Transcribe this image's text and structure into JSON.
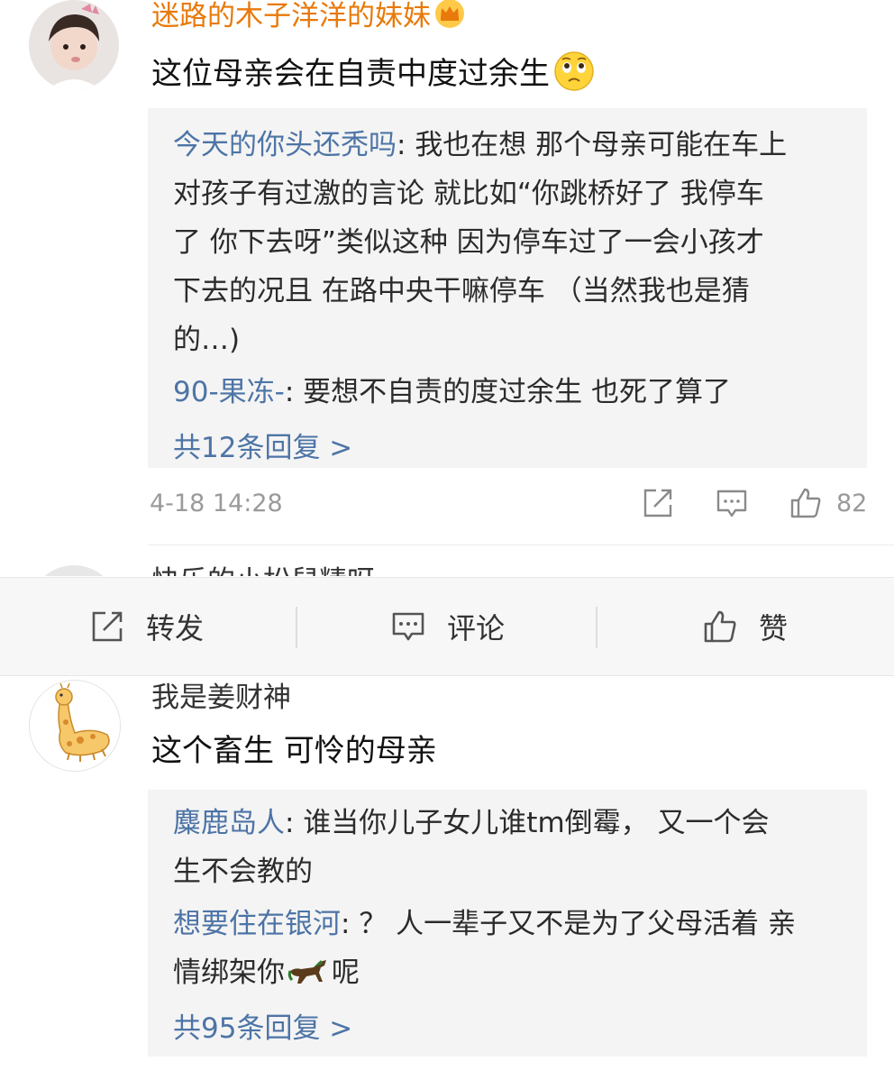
{
  "comments": [
    {
      "username": "迷路的木子洋洋的妹妹",
      "text": "这位母亲会在自责中度过余生",
      "emoji": "worried-face-emoji",
      "replies": [
        {
          "author": "今天的你头还秃吗",
          "lines": [
            "我也在想 那个母亲可能在车上",
            "对孩子有过激的言论 就比如“你跳桥好了 我停车",
            "了 你下去呀”类似这种 因为停车过了一会小孩才",
            "下去的况且 在路中央干嘛停车 （当然我也是猜",
            "的…)"
          ]
        },
        {
          "author": "90-果冻-",
          "lines": [
            "要想不自责的度过余生 也死了算了"
          ]
        }
      ],
      "more_replies": "共12条回复 >",
      "timestamp": "4-18 14:28",
      "like_count": "82"
    },
    {
      "username": "我是姜财神",
      "text": "这个畜生 可怜的母亲",
      "replies": [
        {
          "author": "麋鹿岛人",
          "lines": [
            "谁当你儿子女儿谁tm倒霉， 又一个会",
            "生不会教的"
          ]
        },
        {
          "author": "想要住在银河",
          "lines": [
            "？ 人一辈子又不是为了父母活着 亲",
            "情绑架你"
          ],
          "tail": "呢"
        }
      ],
      "more_replies": "共95条回复 >"
    }
  ],
  "peek_comment": {
    "username": "快乐的小松鼠精呀"
  },
  "toolbar": {
    "repost": "转发",
    "comment": "评论",
    "like": "赞"
  },
  "colors": {
    "vip_name": "#e8790a",
    "link_blue": "#4d74a6",
    "reply_bg": "#f4f4f4",
    "meta_gray": "#9a9a9a"
  }
}
